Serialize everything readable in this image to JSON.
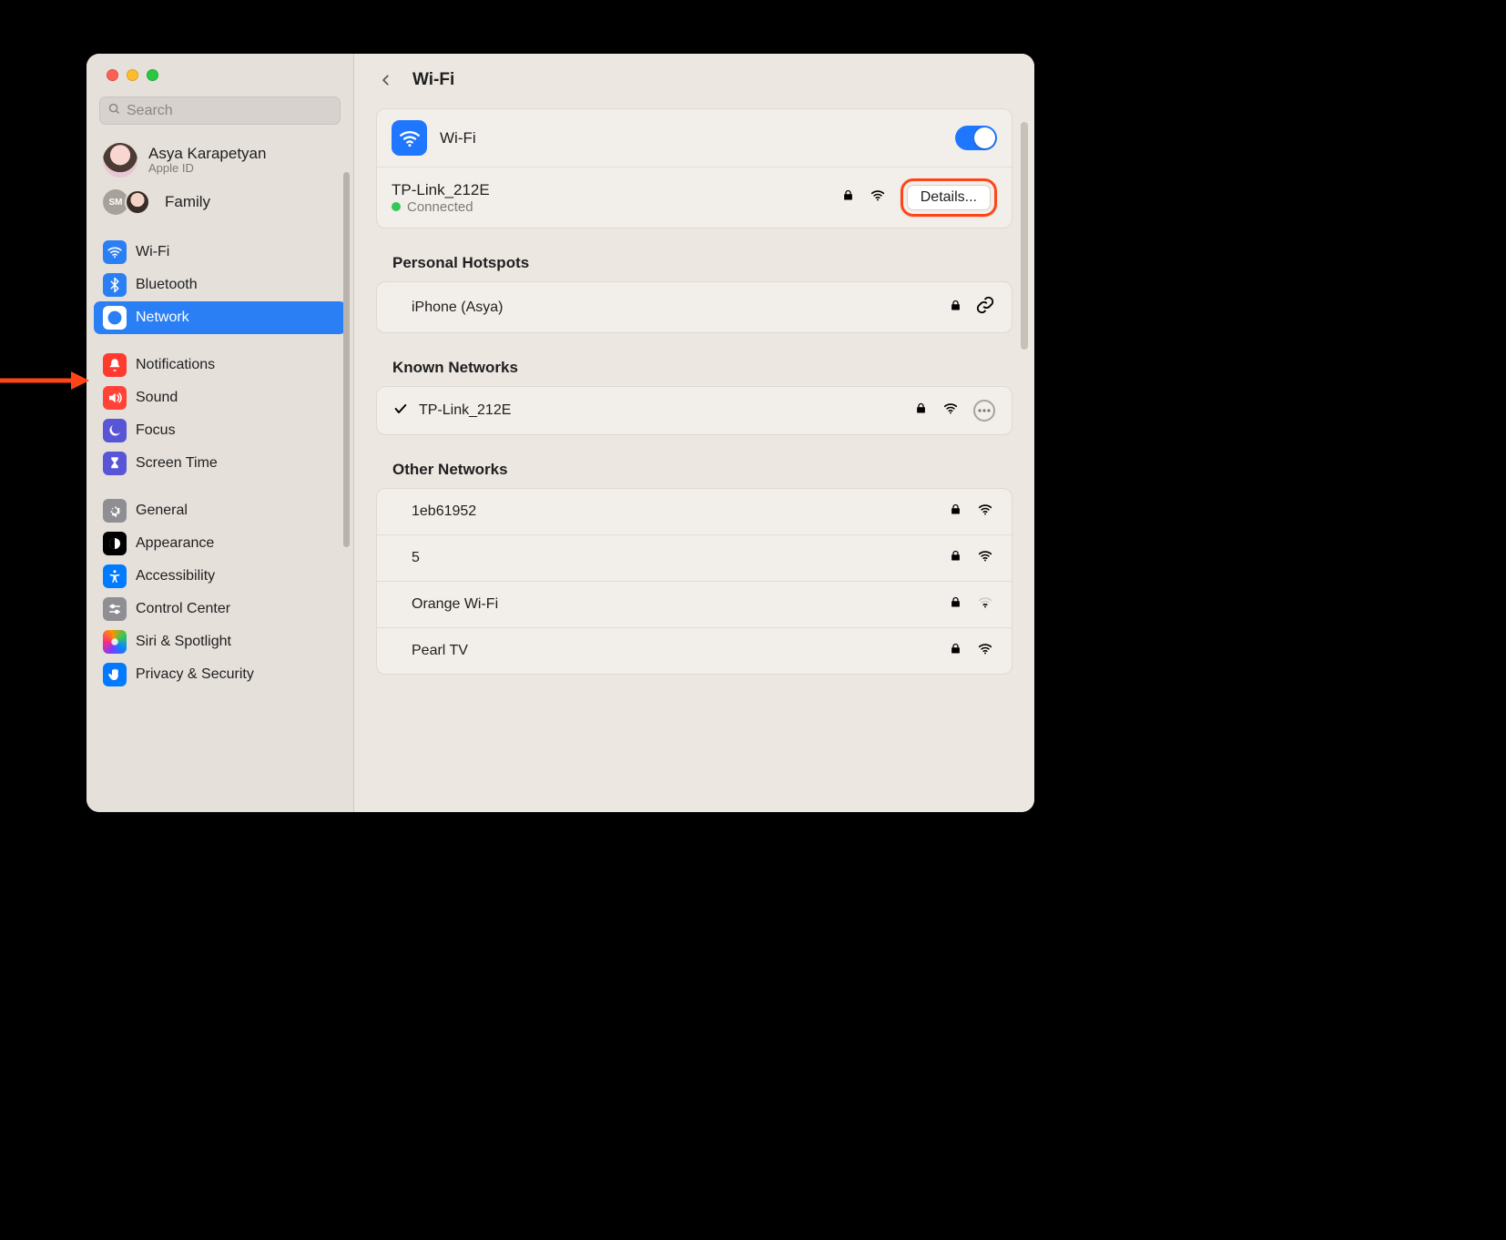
{
  "search": {
    "placeholder": "Search"
  },
  "profile": {
    "name": "Asya Karapetyan",
    "sub": "Apple ID"
  },
  "family": {
    "label": "Family",
    "badge": "SM"
  },
  "sidebar": {
    "items": [
      {
        "label": "Wi-Fi"
      },
      {
        "label": "Bluetooth"
      },
      {
        "label": "Network"
      },
      {
        "label": "Notifications"
      },
      {
        "label": "Sound"
      },
      {
        "label": "Focus"
      },
      {
        "label": "Screen Time"
      },
      {
        "label": "General"
      },
      {
        "label": "Appearance"
      },
      {
        "label": "Accessibility"
      },
      {
        "label": "Control Center"
      },
      {
        "label": "Siri & Spotlight"
      },
      {
        "label": "Privacy & Security"
      }
    ]
  },
  "header": {
    "title": "Wi-Fi"
  },
  "wifi": {
    "label": "Wi-Fi",
    "connected_name": "TP-Link_212E",
    "status": "Connected",
    "details_label": "Details...",
    "toggle_on": true
  },
  "sections": {
    "hotspots_title": "Personal Hotspots",
    "known_title": "Known Networks",
    "other_title": "Other Networks"
  },
  "hotspots": [
    {
      "label": "iPhone (Asya)"
    }
  ],
  "known": [
    {
      "label": "TP-Link_212E",
      "checked": true
    }
  ],
  "other": [
    {
      "label": "1eb61952",
      "strong": true
    },
    {
      "label": "5",
      "strong": true
    },
    {
      "label": "Orange Wi-Fi",
      "strong": false
    },
    {
      "label": "Pearl TV",
      "strong": true
    }
  ]
}
